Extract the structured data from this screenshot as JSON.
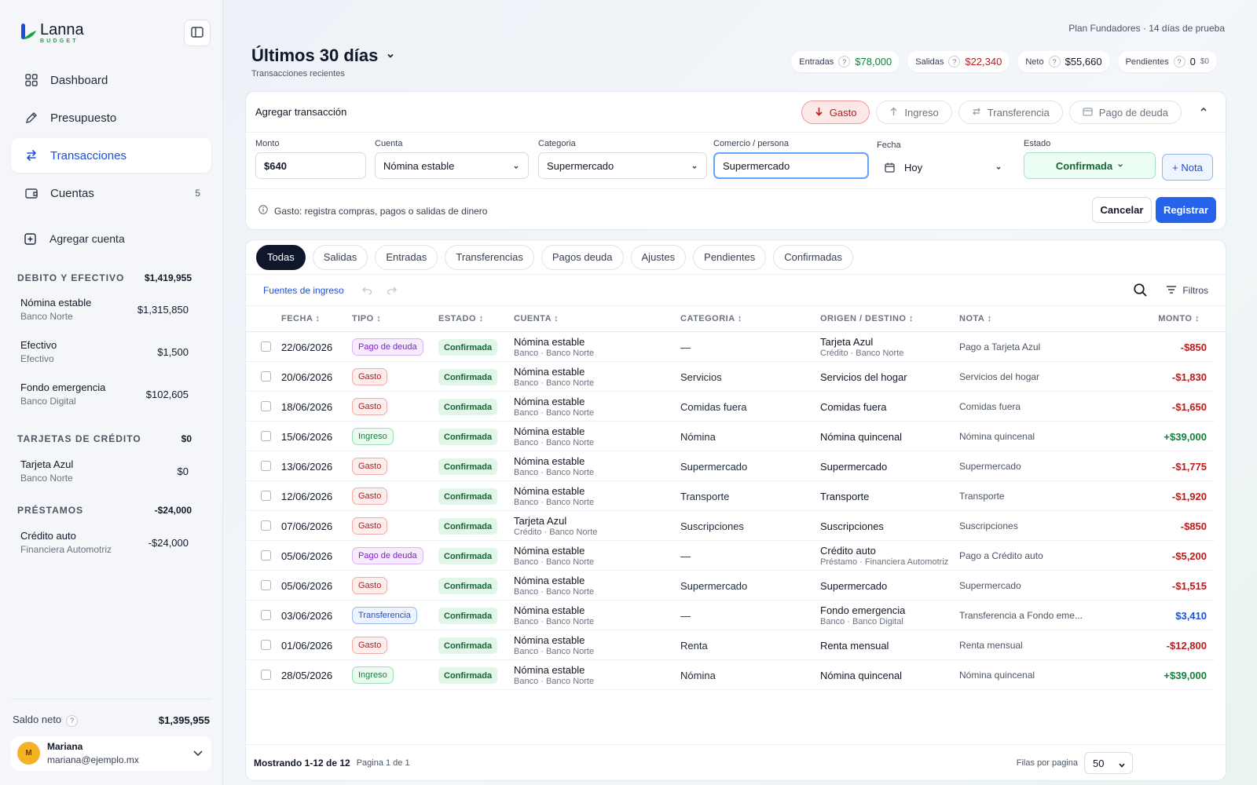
{
  "brand": {
    "name": "Lanna",
    "sub": "BUDGET",
    "green": "#16a34a"
  },
  "nav": [
    {
      "label": "Dashboard",
      "icon": "grid-icon"
    },
    {
      "label": "Presupuesto",
      "icon": "pencil-icon"
    },
    {
      "label": "Transacciones",
      "icon": "swap-icon",
      "active": true
    },
    {
      "label": "Cuentas",
      "icon": "wallet-icon",
      "count": "5"
    }
  ],
  "add_account": "Agregar cuenta",
  "sections": [
    {
      "title": "DEBITO Y EFECTIVO",
      "total": "$1,419,955",
      "accounts": [
        {
          "name": "Nómina estable",
          "sub": "Banco Norte",
          "amount": "$1,315,850"
        },
        {
          "name": "Efectivo",
          "sub": "Efectivo",
          "amount": "$1,500"
        },
        {
          "name": "Fondo emergencia",
          "sub": "Banco Digital",
          "amount": "$102,605"
        }
      ]
    },
    {
      "title": "TARJETAS DE CRÉDITO",
      "total": "$0",
      "accounts": [
        {
          "name": "Tarjeta Azul",
          "sub": "Banco Norte",
          "amount": "$0"
        }
      ]
    },
    {
      "title": "PRÉSTAMOS",
      "total": "-$24,000",
      "accounts": [
        {
          "name": "Crédito auto",
          "sub": "Financiera Automotriz",
          "amount": "-$24,000"
        }
      ]
    }
  ],
  "saldo": {
    "label": "Saldo neto",
    "value": "$1,395,955"
  },
  "user": {
    "initial": "M",
    "name": "Mariana",
    "email": "mariana@ejemplo.mx"
  },
  "header": {
    "plan": "Plan Fundadores  ·  14 días de prueba",
    "title": "Últimos 30 días",
    "subtitle": "Transacciones recientes",
    "stats": [
      {
        "label": "Entradas",
        "value": "$78,000",
        "tone": "green"
      },
      {
        "label": "Salidas",
        "value": "$22,340",
        "tone": "red"
      },
      {
        "label": "Neto",
        "value": "$55,660",
        "tone": "dark"
      },
      {
        "label": "Pendientes",
        "value": "0",
        "extra": "$0",
        "tone": "dark"
      }
    ]
  },
  "add_form": {
    "title": "Agregar transacción",
    "types": [
      "Gasto",
      "Ingreso",
      "Transferencia",
      "Pago de deuda"
    ],
    "monto_label": "Monto",
    "monto_value": "$640",
    "cuenta_label": "Cuenta",
    "cuenta_value": "Nómina estable",
    "categoria_label": "Categoria",
    "categoria_value": "Supermercado",
    "comercio_label": "Comercio / persona",
    "comercio_value": "Supermercado",
    "fecha_label": "Fecha",
    "fecha_value": "Hoy",
    "estado_label": "Estado",
    "estado_value": "Confirmada",
    "nota_button": "+ Nota",
    "hint": "Gasto: registra compras, pagos o salidas de dinero",
    "cancel": "Cancelar",
    "submit": "Registrar"
  },
  "filters": [
    "Todas",
    "Salidas",
    "Entradas",
    "Transferencias",
    "Pagos deuda",
    "Ajustes",
    "Pendientes",
    "Confirmadas"
  ],
  "toolbar": {
    "fuentes": "Fuentes de ingreso",
    "filtros": "Filtros"
  },
  "columns": [
    "FECHA ↕",
    "TIPO ↕",
    "ESTADO ↕",
    "CUENTA ↕",
    "CATEGORIA ↕",
    "ORIGEN / DESTINO ↕",
    "NOTA ↕",
    "MONTO ↕"
  ],
  "rows": [
    {
      "date": "22/06/2026",
      "type": "Pago de deuda",
      "kind": "deuda",
      "status": "Confirmada",
      "account": "Nómina estable",
      "account_sub": "Banco · Banco Norte",
      "category": "—",
      "origin": "Tarjeta Azul",
      "origin_sub": "Crédito · Banco Norte",
      "note": "Pago a Tarjeta Azul",
      "amount": "-$850",
      "tone": "neg"
    },
    {
      "date": "20/06/2026",
      "type": "Gasto",
      "kind": "gasto",
      "status": "Confirmada",
      "account": "Nómina estable",
      "account_sub": "Banco · Banco Norte",
      "category": "Servicios",
      "origin": "Servicios del hogar",
      "origin_sub": "",
      "note": "Servicios del hogar",
      "amount": "-$1,830",
      "tone": "neg"
    },
    {
      "date": "18/06/2026",
      "type": "Gasto",
      "kind": "gasto",
      "status": "Confirmada",
      "account": "Nómina estable",
      "account_sub": "Banco · Banco Norte",
      "category": "Comidas fuera",
      "origin": "Comidas fuera",
      "origin_sub": "",
      "note": "Comidas fuera",
      "amount": "-$1,650",
      "tone": "neg"
    },
    {
      "date": "15/06/2026",
      "type": "Ingreso",
      "kind": "ingreso",
      "status": "Confirmada",
      "account": "Nómina estable",
      "account_sub": "Banco · Banco Norte",
      "category": "Nómina",
      "origin": "Nómina quincenal",
      "origin_sub": "",
      "note": "Nómina quincenal",
      "amount": "+$39,000",
      "tone": "pos"
    },
    {
      "date": "13/06/2026",
      "type": "Gasto",
      "kind": "gasto",
      "status": "Confirmada",
      "account": "Nómina estable",
      "account_sub": "Banco · Banco Norte",
      "category": "Supermercado",
      "origin": "Supermercado",
      "origin_sub": "",
      "note": "Supermercado",
      "amount": "-$1,775",
      "tone": "neg"
    },
    {
      "date": "12/06/2026",
      "type": "Gasto",
      "kind": "gasto",
      "status": "Confirmada",
      "account": "Nómina estable",
      "account_sub": "Banco · Banco Norte",
      "category": "Transporte",
      "origin": "Transporte",
      "origin_sub": "",
      "note": "Transporte",
      "amount": "-$1,920",
      "tone": "neg"
    },
    {
      "date": "07/06/2026",
      "type": "Gasto",
      "kind": "gasto",
      "status": "Confirmada",
      "account": "Tarjeta Azul",
      "account_sub": "Crédito · Banco Norte",
      "category": "Suscripciones",
      "origin": "Suscripciones",
      "origin_sub": "",
      "note": "Suscripciones",
      "amount": "-$850",
      "tone": "neg"
    },
    {
      "date": "05/06/2026",
      "type": "Pago de deuda",
      "kind": "deuda",
      "status": "Confirmada",
      "account": "Nómina estable",
      "account_sub": "Banco · Banco Norte",
      "category": "—",
      "origin": "Crédito auto",
      "origin_sub": "Préstamo · Financiera Automotriz",
      "note": "Pago a Crédito auto",
      "amount": "-$5,200",
      "tone": "neg"
    },
    {
      "date": "05/06/2026",
      "type": "Gasto",
      "kind": "gasto",
      "status": "Confirmada",
      "account": "Nómina estable",
      "account_sub": "Banco · Banco Norte",
      "category": "Supermercado",
      "origin": "Supermercado",
      "origin_sub": "",
      "note": "Supermercado",
      "amount": "-$1,515",
      "tone": "neg"
    },
    {
      "date": "03/06/2026",
      "type": "Transferencia",
      "kind": "transf",
      "status": "Confirmada",
      "account": "Nómina estable",
      "account_sub": "Banco · Banco Norte",
      "category": "—",
      "origin": "Fondo emergencia",
      "origin_sub": "Banco · Banco Digital",
      "note": "Transferencia a Fondo eme...",
      "amount": "$3,410",
      "tone": "blue"
    },
    {
      "date": "01/06/2026",
      "type": "Gasto",
      "kind": "gasto",
      "status": "Confirmada",
      "account": "Nómina estable",
      "account_sub": "Banco · Banco Norte",
      "category": "Renta",
      "origin": "Renta mensual",
      "origin_sub": "",
      "note": "Renta mensual",
      "amount": "-$12,800",
      "tone": "neg"
    },
    {
      "date": "28/05/2026",
      "type": "Ingreso",
      "kind": "ingreso",
      "status": "Confirmada",
      "account": "Nómina estable",
      "account_sub": "Banco · Banco Norte",
      "category": "Nómina",
      "origin": "Nómina quincenal",
      "origin_sub": "",
      "note": "Nómina quincenal",
      "amount": "+$39,000",
      "tone": "pos"
    }
  ],
  "footer": {
    "showing": "Mostrando 1-12 de 12",
    "page": "Pagina 1 de 1",
    "rows_label": "Filas por pagina",
    "rows_value": "50"
  }
}
